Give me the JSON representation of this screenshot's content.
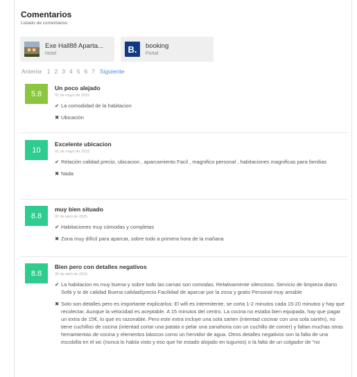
{
  "header": {
    "title": "Comentarios",
    "subtitle": "Listado de comentarios"
  },
  "sources": [
    {
      "name": "Exe Hall88 Aparta...",
      "type": "Hotel"
    },
    {
      "name": "booking",
      "type": "Portal",
      "logo_letter": "B."
    }
  ],
  "pagination": {
    "prev": "Anterior",
    "pages": [
      "1",
      "2",
      "3",
      "4",
      "5",
      "6",
      "7"
    ],
    "next": "Siguiente"
  },
  "colors": {
    "score_light_green": "#8cc63e",
    "score_green": "#2ecc8f",
    "booking_blue": "#123a80",
    "link_blue": "#5a8ad8"
  },
  "icons": {
    "positive": "check-icon",
    "negative": "cross-icon"
  },
  "reviews": [
    {
      "score": "5.8",
      "title": "Un poco alejado",
      "date": "02 de mayo de 2015",
      "positive": "La comodidad de la habitacion",
      "negative": "Ubicación"
    },
    {
      "score": "10",
      "title": "Excelente ubicacion",
      "date": "01 de mayo de 2015",
      "positive": "Relación calidad precio, ubicacion , aparcamiento Facil , magnifico personal , habitaciones magnificas para familias",
      "negative": "Nada"
    },
    {
      "score": "8.8",
      "title": "muy bien situado",
      "date": "02 de abril de 2015",
      "positive": "Habitaciones muy cómodas y completas",
      "negative": "Zona muy difícil para aparcar, sobre todo a primera hora de la mañana"
    },
    {
      "score": "8.8",
      "title": "Bien pero con detalles negativos",
      "date": "30 de abril de 2015",
      "positive": "La habitacion es muy buena y sobre todo las camas son comodas. Relativamente silencioso. Servicio de limpieza diario Sofá y tv de calidad Buena calidad/precio Facilidad de aparcar por la zona y gratis Personal muy amable",
      "negative": "Solo son detalles pero es importante explicarlos: El wifi es intermitente, se corta 1-2 minutos cada 15-20 minutos y hay que recolectar. Aunque la velocidad es aceptable. A 15 minutos del centro. La cocina no estaba bien equipada, hay que pagar un extra de 15€, lo que es razonable. Pero este extra incluye una sola sarten (intentad cocinar con una sola sartén), no tiene cuchillos de cocina (intentad cortar una patata o pelar una zanahoria con un cuchillo de comer) y faltan muchas otras herramientas de cocina y elementos básicos como un hervidor de agua. Otros detalles negativos son la falta de una escobilla en el wc (nunca lo había visto y eso que he estado alojado en tugurios) o la falta de un colgador de \"no"
    }
  ]
}
